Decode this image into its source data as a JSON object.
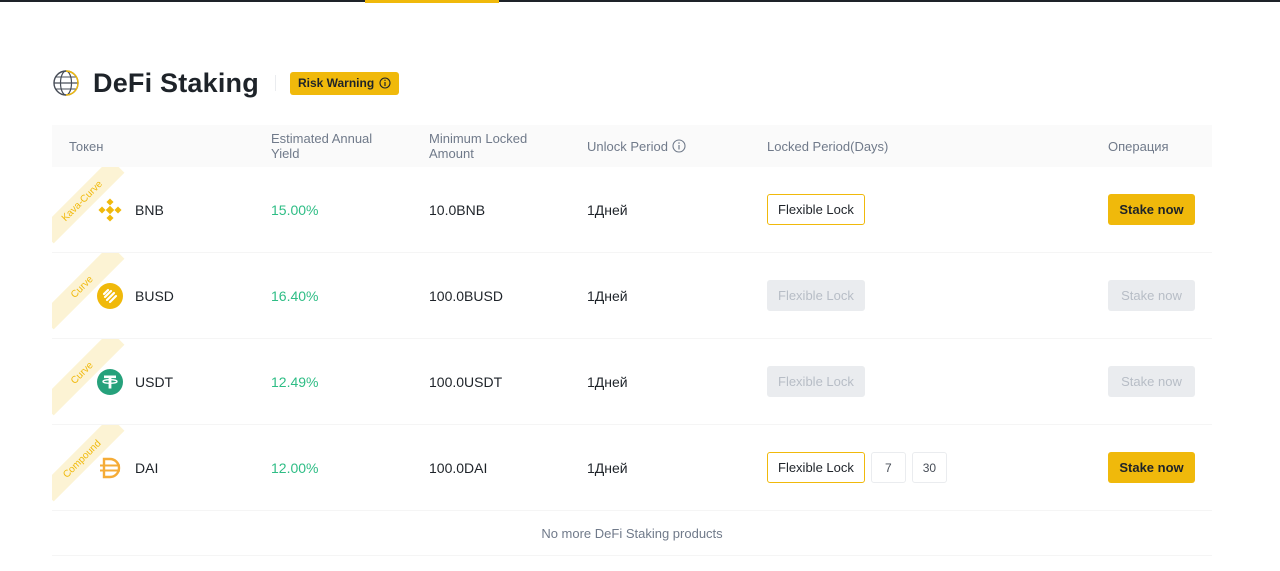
{
  "page": {
    "title": "DeFi Staking",
    "risk_warning_label": "Risk Warning",
    "colors": {
      "accent": "#f0b90b",
      "yield_green": "#2ebd85",
      "text": "#1e2329",
      "muted": "#707a8a"
    }
  },
  "table": {
    "headers": {
      "token": "Токен",
      "yield": "Estimated Annual Yield",
      "min_amount": "Minimum Locked Amount",
      "unlock_period": "Unlock Period",
      "locked_period": "Locked Period(Days)",
      "operation": "Операция"
    },
    "rows": [
      {
        "tag": "Kava-Curve",
        "token": "BNB",
        "icon": "bnb-icon",
        "yield": "15.00%",
        "min_amount": "10.0BNB",
        "unlock": "1Дней",
        "lock_label": "Flexible Lock",
        "lock_enabled": true,
        "days": [],
        "stake_label": "Stake now",
        "stake_enabled": true
      },
      {
        "tag": "Curve",
        "token": "BUSD",
        "icon": "busd-icon",
        "yield": "16.40%",
        "min_amount": "100.0BUSD",
        "unlock": "1Дней",
        "lock_label": "Flexible Lock",
        "lock_enabled": false,
        "days": [],
        "stake_label": "Stake now",
        "stake_enabled": false
      },
      {
        "tag": "Curve",
        "token": "USDT",
        "icon": "usdt-icon",
        "yield": "12.49%",
        "min_amount": "100.0USDT",
        "unlock": "1Дней",
        "lock_label": "Flexible Lock",
        "lock_enabled": false,
        "days": [],
        "stake_label": "Stake now",
        "stake_enabled": false
      },
      {
        "tag": "Compound",
        "token": "DAI",
        "icon": "dai-icon",
        "yield": "12.00%",
        "min_amount": "100.0DAI",
        "unlock": "1Дней",
        "lock_label": "Flexible Lock",
        "lock_enabled": true,
        "days": [
          "7",
          "30"
        ],
        "stake_label": "Stake now",
        "stake_enabled": true
      }
    ],
    "footer_text": "No more DeFi Staking products"
  }
}
